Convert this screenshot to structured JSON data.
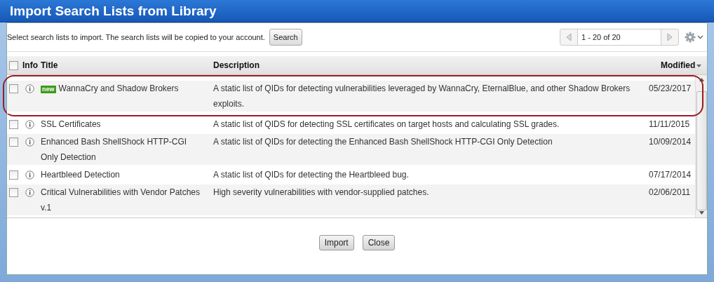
{
  "window": {
    "title": "Import Search Lists from Library"
  },
  "toolbar": {
    "instructions": "Select search lists to import. The search lists will be copied to your account.",
    "search_button": "Search",
    "pager": "1 - 20 of 20"
  },
  "table": {
    "select_all_checked": false,
    "columns": [
      {
        "label": "Info",
        "sorted": false
      },
      {
        "label": "Title",
        "sorted": false
      },
      {
        "label": "Description",
        "sorted": false
      },
      {
        "label": "Modified",
        "sorted": true
      }
    ],
    "rows": [
      {
        "checked": false,
        "new": true,
        "highlighted": true,
        "title": "WannaCry and Shadow Brokers",
        "description": "A static list of QIDs for detecting vulnerabilities leveraged by WannaCry, EternalBlue, and other Shadow Brokers exploits.",
        "modified": "05/23/2017"
      },
      {
        "checked": false,
        "new": false,
        "highlighted": false,
        "title": "SSL Certificates",
        "description": "A static list of QIDS for detecting SSL certificates on target hosts and calculating SSL grades.",
        "modified": "11/11/2015"
      },
      {
        "checked": false,
        "new": false,
        "highlighted": false,
        "title": "Enhanced Bash ShellShock HTTP-CGI Only Detection",
        "description": "A static list of QIDs for detecting the Enhanced Bash ShellShock HTTP-CGI Only Detection",
        "modified": "10/09/2014"
      },
      {
        "checked": false,
        "new": false,
        "highlighted": false,
        "title": "Heartbleed Detection",
        "description": "A static list of QIDs for detecting the Heartbleed bug.",
        "modified": "07/17/2014"
      },
      {
        "checked": false,
        "new": false,
        "highlighted": false,
        "title": "Critical Vulnerabilities with Vendor Patches v.1",
        "description": "High severity vulnerabilities with vendor-supplied patches.",
        "modified": "02/06/2011"
      }
    ]
  },
  "new_badge": "new",
  "buttons": [
    "Import",
    "Close"
  ]
}
